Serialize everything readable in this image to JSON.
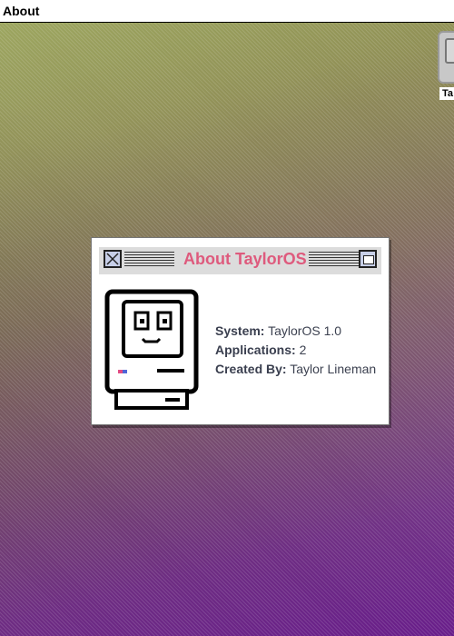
{
  "menubar": {
    "title": "About"
  },
  "desktop": {
    "icon": {
      "label": "Ta",
      "icon": "computer-icon"
    }
  },
  "window": {
    "title": "About TaylorOS",
    "title_color": "#de5a7d",
    "rows": [
      {
        "label": "System:",
        "value": "TaylorOS 1.0"
      },
      {
        "label": "Applications:",
        "value": "2"
      },
      {
        "label": "Created By:",
        "value": "Taylor Lineman"
      }
    ]
  }
}
